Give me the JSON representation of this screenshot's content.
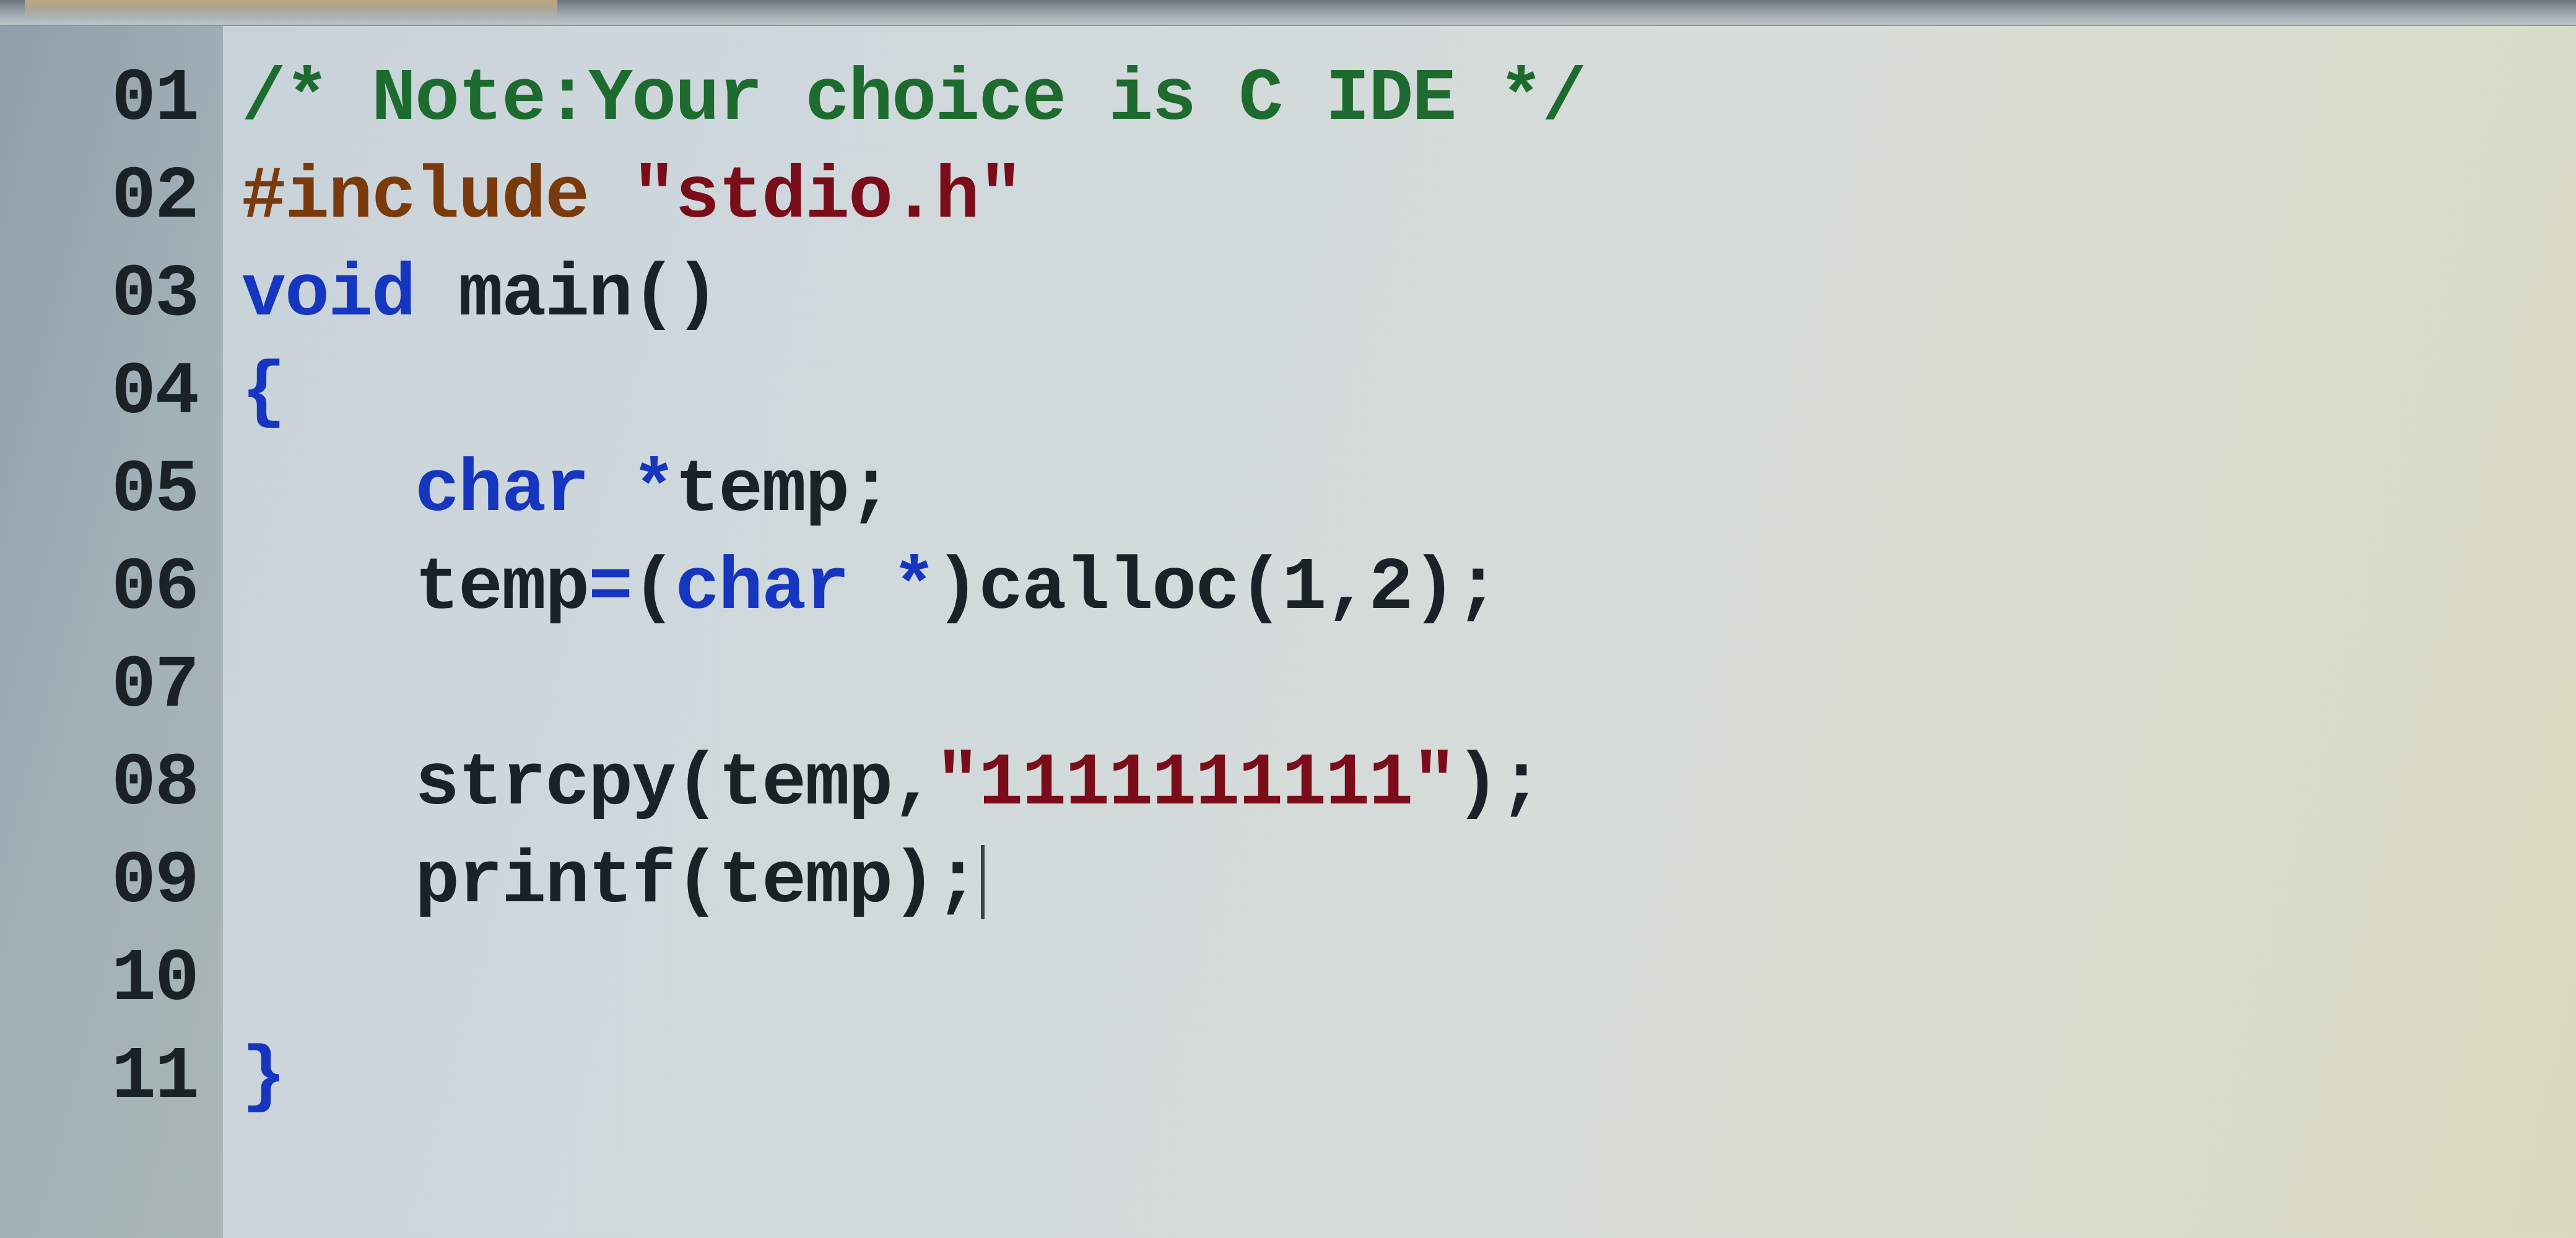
{
  "gutter": {
    "lines": [
      "01",
      "02",
      "03",
      "04",
      "05",
      "06",
      "07",
      "08",
      "09",
      "10",
      "11"
    ]
  },
  "code": {
    "l1": {
      "comment": "/* Note:Your choice is C IDE */"
    },
    "l2": {
      "pre": "#include ",
      "str": "\"stdio.h\""
    },
    "l3": {
      "kw": "void",
      "sp": " ",
      "fn": "main",
      "paren": "()"
    },
    "l4": {
      "brace": "{"
    },
    "l5": {
      "indent": "    ",
      "type": "char",
      "sp": " ",
      "star": "*",
      "ident": "temp",
      "semi": ";"
    },
    "l6": {
      "indent": "    ",
      "ident1": "temp",
      "eq": "=",
      "lp": "(",
      "type": "char",
      "sp": " ",
      "star": "*",
      "rp": ")",
      "fn": "calloc",
      "args_open": "(",
      "n1": "1",
      "comma": ",",
      "n2": "2",
      "args_close": ")",
      "semi": ";"
    },
    "l7": {
      "blank": ""
    },
    "l8": {
      "indent": "    ",
      "fn": "strcpy",
      "lp": "(",
      "ident": "temp",
      "comma": ",",
      "str": "\"1111111111\"",
      "rp": ")",
      "semi": ";"
    },
    "l9": {
      "indent": "    ",
      "fn": "printf",
      "lp": "(",
      "ident": "temp",
      "rp": ")",
      "semi": ";"
    },
    "l10": {
      "blank": ""
    },
    "l11": {
      "brace": "}"
    }
  }
}
